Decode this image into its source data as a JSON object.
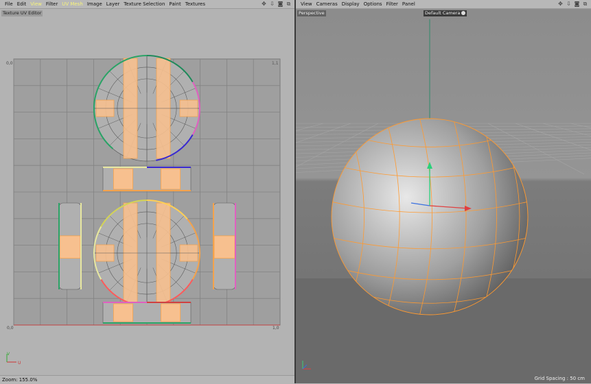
{
  "uv_editor": {
    "menu": [
      "File",
      "Edit",
      "View",
      "Filter",
      "UV Mesh",
      "Image",
      "Layer",
      "Texture Selection",
      "Paint",
      "Textures"
    ],
    "active_menus": [
      "View",
      "UV Mesh"
    ],
    "panel_title": "Texture UV Editor",
    "corner_labels": {
      "top_left": "0,0",
      "top_right": "1,1",
      "bottom_left": "0,0",
      "bottom_right": "1,0"
    },
    "axis_labels": {
      "u": "U",
      "v": "V"
    },
    "zoom": "Zoom: 155.0%"
  },
  "viewport": {
    "menu": [
      "View",
      "Cameras",
      "Display",
      "Options",
      "Filter",
      "Panel"
    ],
    "panel_title": "Perspective",
    "camera": "Default Camera",
    "grid_spacing": "Grid Spacing : 50 cm"
  },
  "colors": {
    "accent_menu": "#f7f37a",
    "uv_edge": "#f5a24a",
    "uv_fill": "#f7c08f",
    "wire": "#ff9a30"
  },
  "icons": {
    "left": [
      "move-icon",
      "down-arrow-icon",
      "camera-icon",
      "maximize-icon"
    ],
    "right": [
      "move-icon",
      "down-arrow-icon",
      "camera-icon",
      "maximize-icon"
    ]
  }
}
